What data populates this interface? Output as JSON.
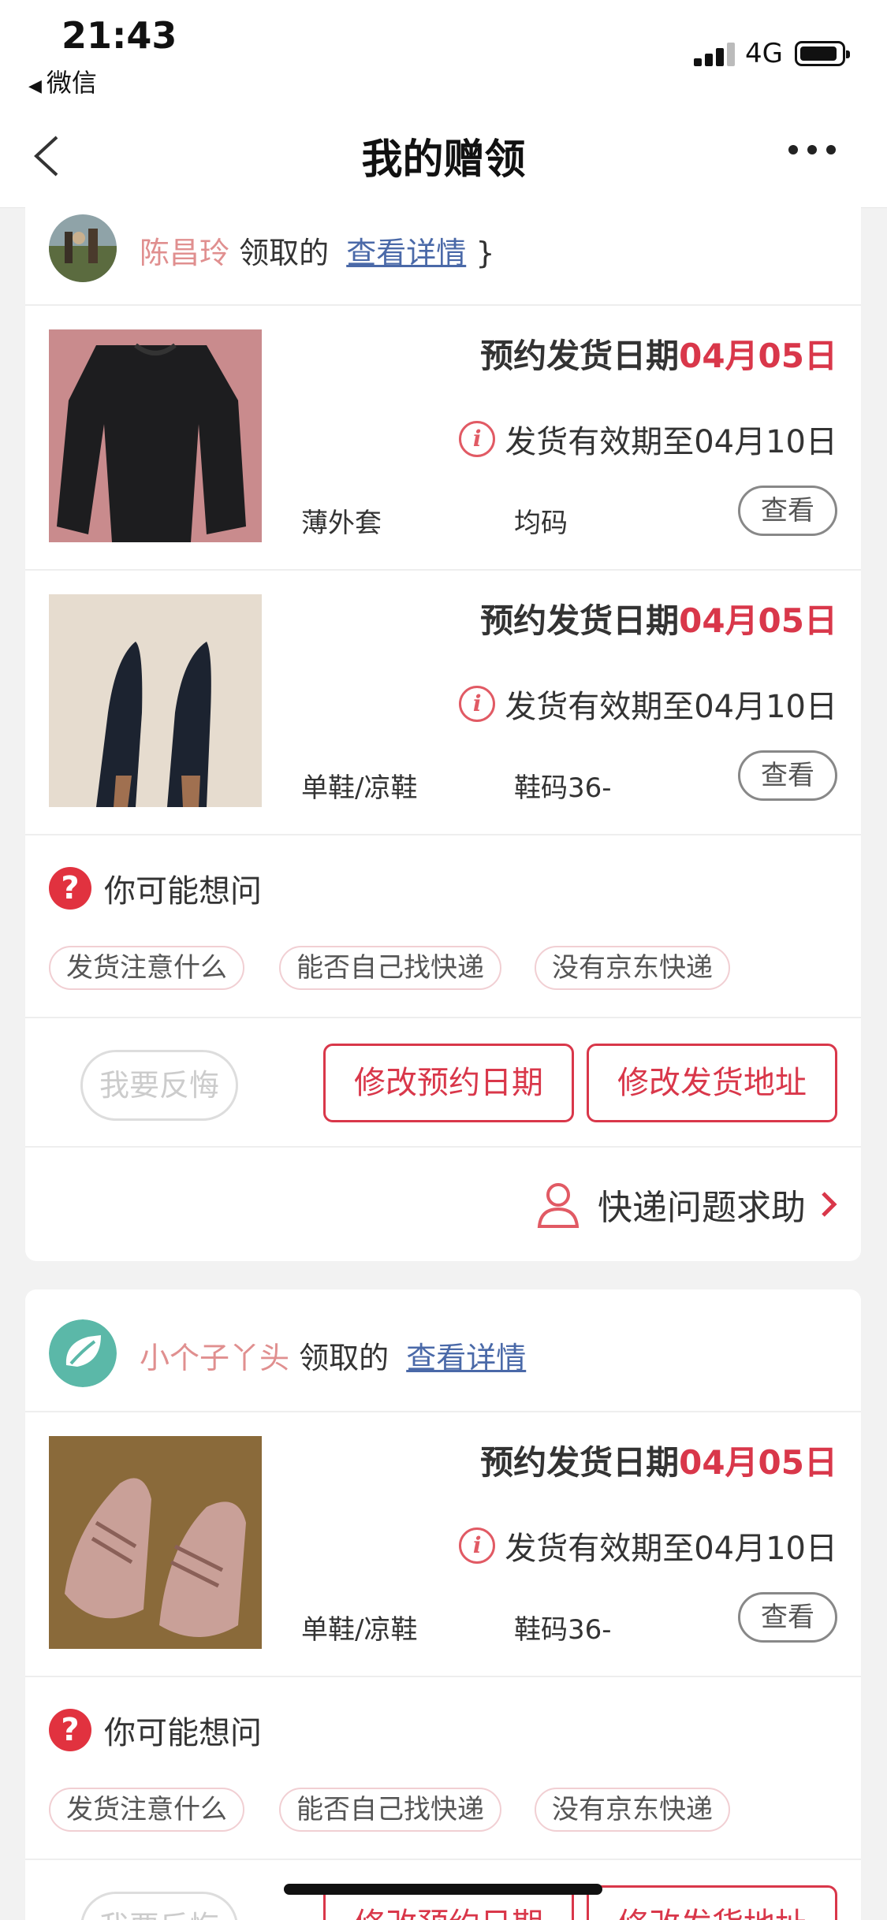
{
  "status_bar": {
    "time": "21:43",
    "back_app": "微信",
    "network": "4G",
    "battery_level": 0.8
  },
  "nav": {
    "title": "我的赠领"
  },
  "colors": {
    "accent": "#d9374a",
    "giver_name": "#e08f8f",
    "link": "#4a69a8"
  },
  "cards": [
    {
      "giver_name": "陈昌玲",
      "received_text": "领取的",
      "detail_link": "查看详情",
      "items": [
        {
          "ship_label": "预约发货日期",
          "ship_date": "04月05日",
          "valid_text": "发货有效期至04月10日",
          "category": "薄外套",
          "size": "均码",
          "view_label": "查看",
          "image": "black-sweater"
        },
        {
          "ship_label": "预约发货日期",
          "ship_date": "04月05日",
          "valid_text": "发货有效期至04月10日",
          "category": "单鞋/凉鞋",
          "size": "鞋码36-",
          "view_label": "查看",
          "image": "black-heels"
        }
      ],
      "faq": {
        "title": "你可能想问",
        "chips": [
          "发货注意什么",
          "能否自己找快递",
          "没有京东快递"
        ]
      },
      "actions": {
        "regret": "我要反悔",
        "change_date": "修改预约日期",
        "change_address": "修改发货地址"
      },
      "help": "快递问题求助"
    },
    {
      "giver_name": "小个子丫头",
      "received_text": "领取的",
      "detail_link": "查看详情",
      "items": [
        {
          "ship_label": "预约发货日期",
          "ship_date": "04月05日",
          "valid_text": "发货有效期至04月10日",
          "category": "单鞋/凉鞋",
          "size": "鞋码36-",
          "view_label": "查看",
          "image": "pink-sneakers"
        }
      ],
      "faq": {
        "title": "你可能想问",
        "chips": [
          "发货注意什么",
          "能否自己找快递",
          "没有京东快递"
        ]
      },
      "actions": {
        "regret": "我要反悔",
        "change_date": "修改预约日期",
        "change_address": "修改发货地址"
      }
    }
  ]
}
